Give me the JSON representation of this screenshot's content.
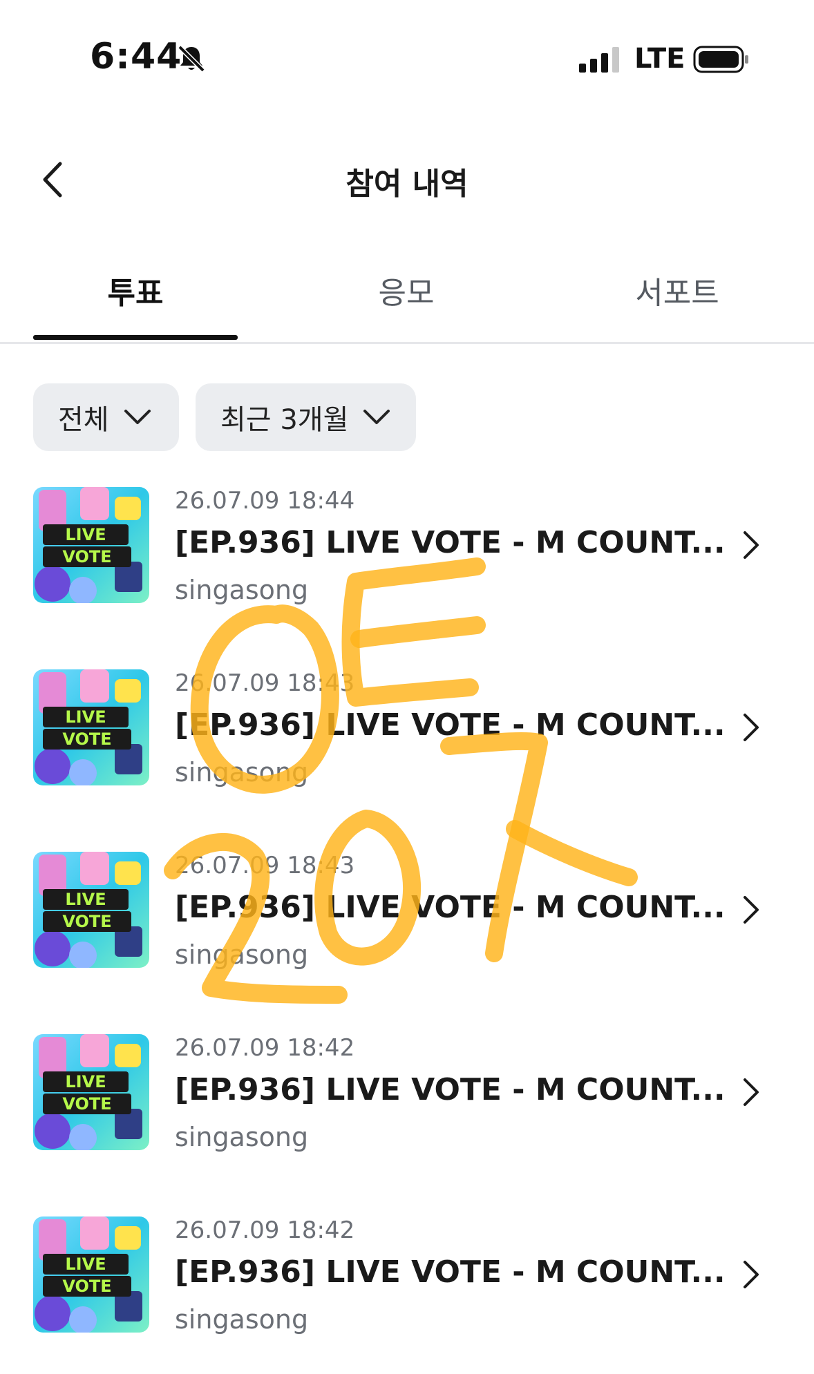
{
  "status_bar": {
    "time": "6:44",
    "network": "LTE"
  },
  "header": {
    "title": "참여 내역"
  },
  "tabs": [
    {
      "label": "투표",
      "active": true
    },
    {
      "label": "응모",
      "active": false
    },
    {
      "label": "서포트",
      "active": false
    }
  ],
  "filters": [
    {
      "label": "전체"
    },
    {
      "label": "최근 3개월"
    }
  ],
  "items": [
    {
      "date": "26.07.09 18:44",
      "title": "[EP.936] LIVE VOTE - M COUNT...",
      "artist": "singasong",
      "thumb_line1": "LIVE",
      "thumb_line2": "VOTE"
    },
    {
      "date": "26.07.09 18:43",
      "title": "[EP.936] LIVE VOTE - M COUNT...",
      "artist": "singasong",
      "thumb_line1": "LIVE",
      "thumb_line2": "VOTE"
    },
    {
      "date": "26.07.09 18:43",
      "title": "[EP.936] LIVE VOTE - M COUNT...",
      "artist": "singasong",
      "thumb_line1": "LIVE",
      "thumb_line2": "VOTE"
    },
    {
      "date": "26.07.09 18:42",
      "title": "[EP.936] LIVE VOTE - M COUNT...",
      "artist": "singasong",
      "thumb_line1": "LIVE",
      "thumb_line2": "VOTE"
    },
    {
      "date": "26.07.09 18:42",
      "title": "[EP.936] LIVE VOTE - M COUNT...",
      "artist": "singasong",
      "thumb_line1": "LIVE",
      "thumb_line2": "VOTE"
    }
  ],
  "colors": {
    "accent": "#111111",
    "filter_bg": "#ebedf0",
    "annotation": "#ffb31a"
  }
}
